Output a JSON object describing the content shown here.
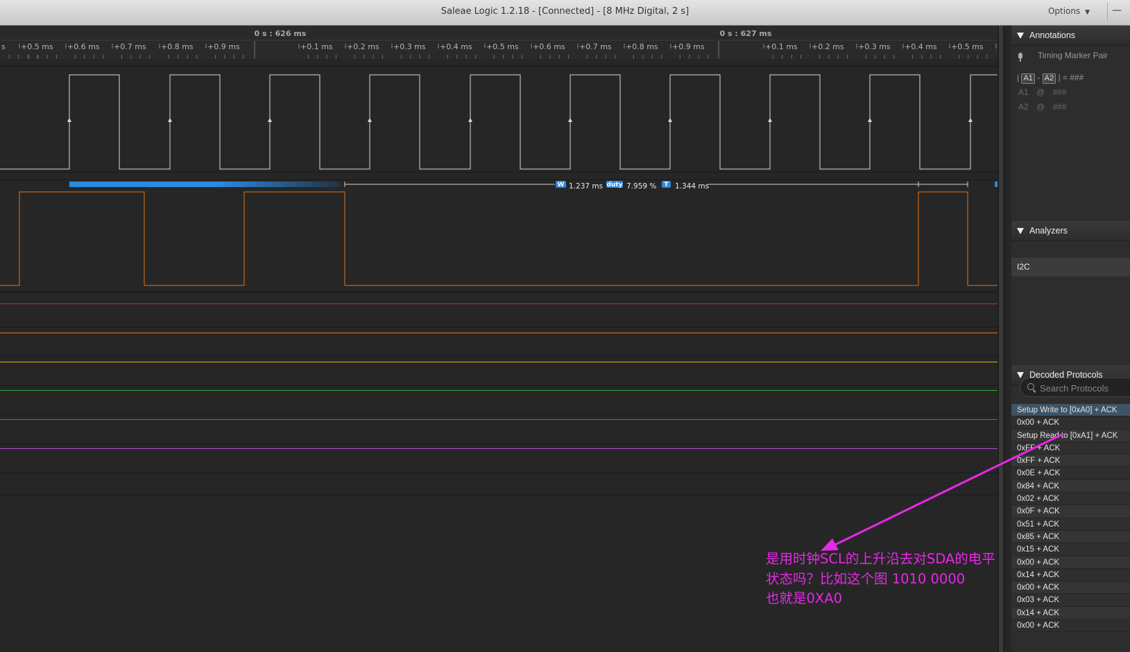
{
  "window": {
    "title": "Saleae Logic 1.2.18 - [Connected] - [8 MHz Digital, 2 s]",
    "options_label": "Options",
    "minimize_label": "—"
  },
  "timeline": {
    "major_labels": [
      "0 s : 626 ms",
      "0 s : 627 ms"
    ],
    "minor_labels": [
      "s",
      "+0.5 ms",
      "+0.6 ms",
      "+0.7 ms",
      "+0.8 ms",
      "+0.9 ms",
      "+0.1 ms",
      "+0.2 ms",
      "+0.3 ms",
      "+0.4 ms",
      "+0.5 ms",
      "+0.6 ms",
      "+0.7 ms",
      "+0.8 ms",
      "+0.9 ms",
      "+0.1 ms",
      "+0.2 ms",
      "+0.3 ms",
      "+0.4 ms",
      "+0.5 ms",
      "+0"
    ]
  },
  "measurement": {
    "width_tag": "W",
    "width_value": "1.237 ms",
    "duty_tag": "duty",
    "duty_value": "7.959 %",
    "period_tag": "T",
    "period_value": "1.344 ms"
  },
  "channels": {
    "colors": {
      "scl": "#d9d9d9",
      "sda": "#e0741c",
      "ch2": "#cc2a2a",
      "ch3": "#e07a14",
      "ch4": "#d6b818",
      "ch5": "#2fb13a",
      "ch6": "#3a6fd6",
      "ch7": "#b64fd6"
    }
  },
  "annotations": {
    "header": "Annotations",
    "marker_pair_label": "Timing Marker Pair",
    "a1": "A1",
    "a2": "A2",
    "sep_dash": "-",
    "sep_pipe": "|",
    "equals_value": "= ###",
    "at": "@",
    "a1_value": "###",
    "a2_value": "###"
  },
  "analyzers": {
    "header": "Analyzers",
    "items": [
      "I2C"
    ]
  },
  "decoded": {
    "header": "Decoded Protocols",
    "search_placeholder": "Search Protocols",
    "rows": [
      "Setup Write to [0xA0] + ACK",
      "0x00 + ACK",
      "Setup Read to [0xA1] + ACK",
      "0xFF + ACK",
      "0xFF + ACK",
      "0x0E + ACK",
      "0x84 + ACK",
      "0x02 + ACK",
      "0x0F + ACK",
      "0x51 + ACK",
      "0x85 + ACK",
      "0x15 + ACK",
      "0x00 + ACK",
      "0x14 + ACK",
      "0x00 + ACK",
      "0x03 + ACK",
      "0x14 + ACK",
      "0x00 + ACK"
    ]
  },
  "annotation_note": {
    "color": "#e629e6",
    "lines": [
      "是用时钟SCL的上升沿去对SDA的电平",
      "状态吗？比如这个图 1010 0000",
      "也就是0XA0"
    ]
  }
}
